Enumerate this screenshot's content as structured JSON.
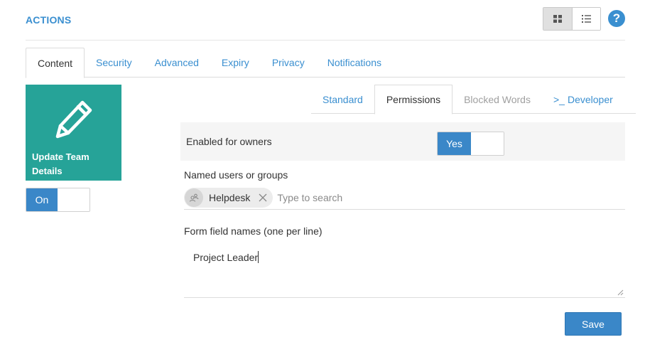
{
  "header": {
    "title": "ACTIONS",
    "view_grid_icon": "grid-icon",
    "view_list_icon": "list-icon",
    "help_label": "?"
  },
  "main_tabs": [
    {
      "label": "Content",
      "active": true
    },
    {
      "label": "Security",
      "active": false
    },
    {
      "label": "Advanced",
      "active": false
    },
    {
      "label": "Expiry",
      "active": false
    },
    {
      "label": "Privacy",
      "active": false
    },
    {
      "label": "Notifications",
      "active": false
    }
  ],
  "action_tile": {
    "icon": "pencil-icon",
    "label": "Update Team Details",
    "toggle_label": "On"
  },
  "sub_tabs": [
    {
      "label": "Standard",
      "state": "normal"
    },
    {
      "label": "Permissions",
      "state": "active"
    },
    {
      "label": "Blocked Words",
      "state": "disabled"
    },
    {
      "label": "Developer",
      "prefix": ">_",
      "state": "normal"
    }
  ],
  "permissions": {
    "enabled_for_owners_label": "Enabled for owners",
    "enabled_for_owners_value": "Yes",
    "named_users_label": "Named users or groups",
    "selected_groups": [
      {
        "label": "Helpdesk",
        "icon": "group-icon"
      }
    ],
    "search_placeholder": "Type to search",
    "form_fields_label": "Form field names (one per line)",
    "form_fields_value": "Project Leader"
  },
  "footer": {
    "save_label": "Save"
  },
  "colors": {
    "accent": "#3a8fd0",
    "tile": "#26a398",
    "toggle_on": "#3a87c8"
  }
}
